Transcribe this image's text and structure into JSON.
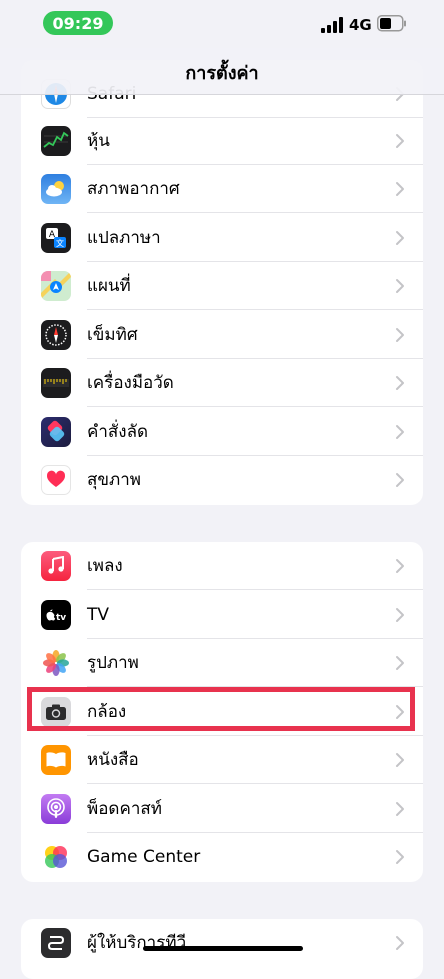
{
  "status": {
    "time": "09:29",
    "network": "4G"
  },
  "nav": {
    "title": "การตั้งค่า"
  },
  "group1": [
    {
      "label": "Safari",
      "icon": "safari-icon"
    },
    {
      "label": "หุ้น",
      "icon": "stocks-icon"
    },
    {
      "label": "สภาพอากาศ",
      "icon": "weather-icon"
    },
    {
      "label": "แปลภาษา",
      "icon": "translate-icon"
    },
    {
      "label": "แผนที่",
      "icon": "maps-icon"
    },
    {
      "label": "เข็มทิศ",
      "icon": "compass-icon"
    },
    {
      "label": "เครื่องมือวัด",
      "icon": "measure-icon"
    },
    {
      "label": "คำสั่งลัด",
      "icon": "shortcuts-icon"
    },
    {
      "label": "สุขภาพ",
      "icon": "health-icon"
    }
  ],
  "group2": [
    {
      "label": "เพลง",
      "icon": "music-icon"
    },
    {
      "label": "TV",
      "icon": "apple-tv-icon"
    },
    {
      "label": "รูปภาพ",
      "icon": "photos-icon"
    },
    {
      "label": "กล้อง",
      "icon": "camera-icon"
    },
    {
      "label": "หนังสือ",
      "icon": "books-icon"
    },
    {
      "label": "พ็อดคาสท์",
      "icon": "podcasts-icon"
    },
    {
      "label": "Game Center",
      "icon": "game-center-icon"
    }
  ],
  "group3": [
    {
      "label": "ผู้ให้บริการทีวี",
      "icon": "tv-provider-icon"
    }
  ],
  "colors": {
    "highlight": "#e8324e",
    "time_pill": "#34c759"
  }
}
